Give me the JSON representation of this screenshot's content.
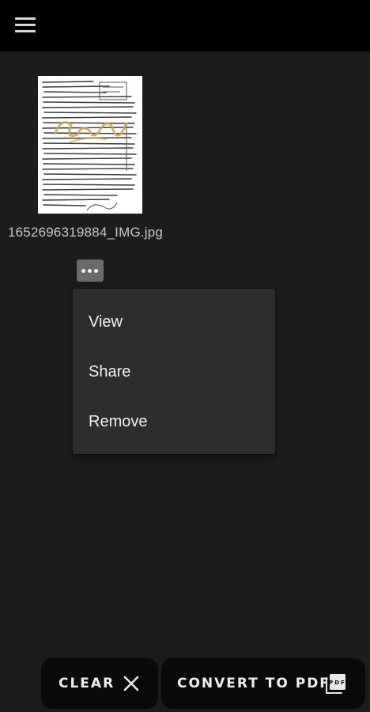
{
  "topbar": {
    "menu_icon": "hamburger-menu-icon"
  },
  "file": {
    "name": "1652696319884_IMG.jpg",
    "thumbnail_icon": "document-image-thumbnail"
  },
  "more_button": {
    "icon": "more-horizontal-icon"
  },
  "context_menu": {
    "items": [
      {
        "label": "View"
      },
      {
        "label": "Share"
      },
      {
        "label": "Remove"
      }
    ]
  },
  "actions": {
    "clear_label": "CLEAR",
    "clear_icon": "close-icon",
    "convert_label": "CONVERT TO PDF",
    "convert_icon": "pdf-file-icon"
  },
  "colors": {
    "background": "#1c1c1c",
    "topbar": "#000000",
    "menu_surface": "#2d2d2d",
    "button_bg": "#0a0a0a"
  }
}
